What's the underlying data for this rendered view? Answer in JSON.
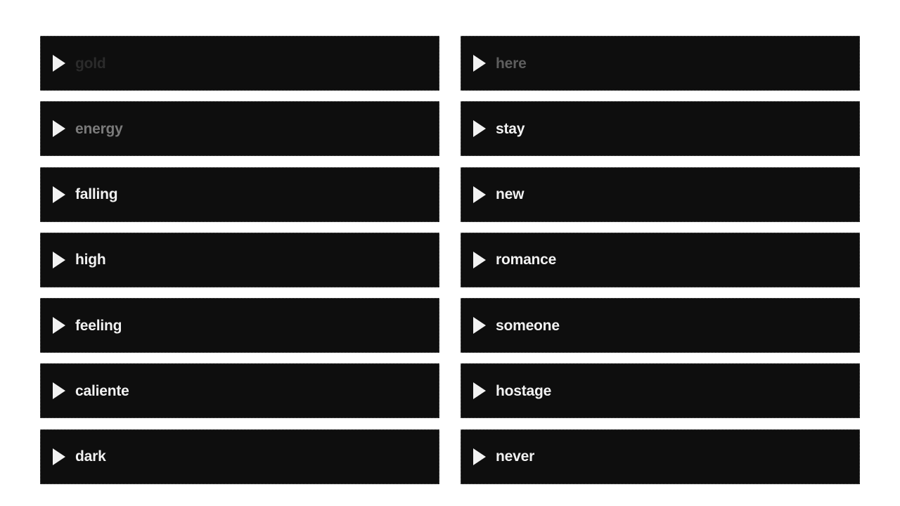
{
  "tiles": [
    {
      "label": "gold",
      "play_icon": "play-icon",
      "text_color": "#2b2b2b"
    },
    {
      "label": "here",
      "play_icon": "play-icon",
      "text_color": "#5e5e5e"
    },
    {
      "label": "energy",
      "play_icon": "play-icon",
      "text_color": "#7a7a7a"
    },
    {
      "label": "stay",
      "play_icon": "play-icon",
      "text_color": "#f2f2f2"
    },
    {
      "label": "falling",
      "play_icon": "play-icon",
      "text_color": "#f2f2f2"
    },
    {
      "label": "new",
      "play_icon": "play-icon",
      "text_color": "#f2f2f2"
    },
    {
      "label": "high",
      "play_icon": "play-icon",
      "text_color": "#f2f2f2"
    },
    {
      "label": "romance",
      "play_icon": "play-icon",
      "text_color": "#f2f2f2"
    },
    {
      "label": "feeling",
      "play_icon": "play-icon",
      "text_color": "#f2f2f2"
    },
    {
      "label": "someone",
      "play_icon": "play-icon",
      "text_color": "#f2f2f2"
    },
    {
      "label": "caliente",
      "play_icon": "play-icon",
      "text_color": "#f2f2f2"
    },
    {
      "label": "hostage",
      "play_icon": "play-icon",
      "text_color": "#f2f2f2"
    },
    {
      "label": "dark",
      "play_icon": "play-icon",
      "text_color": "#f2f2f2"
    },
    {
      "label": "never",
      "play_icon": "play-icon",
      "text_color": "#f2f2f2"
    }
  ],
  "colors": {
    "page_background": "#ffffff",
    "tile_background": "#0e0e0e",
    "tile_border": "#5a5a5a",
    "icon": "#f2f2f2"
  }
}
